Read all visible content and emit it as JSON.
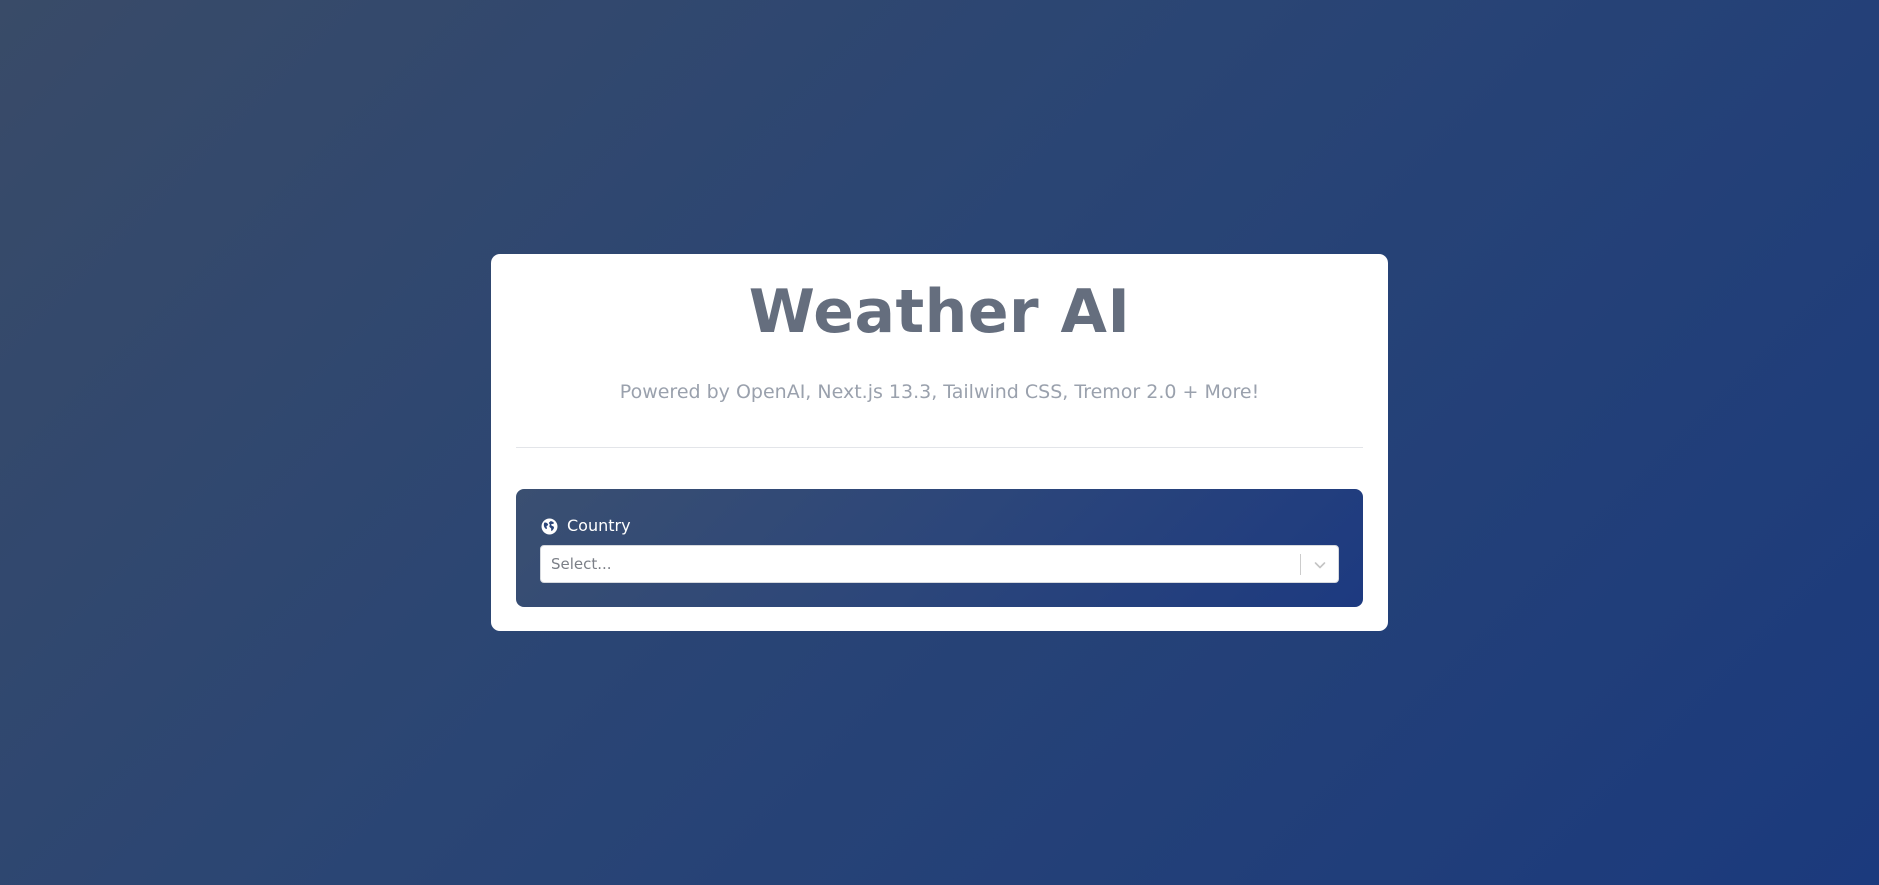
{
  "app": {
    "title": "Weather AI",
    "subtitle": "Powered by OpenAI, Next.js 13.3, Tailwind CSS, Tremor 2.0 + More!"
  },
  "country_field": {
    "label": "Country",
    "icon": "globe-icon",
    "selected_value": "Select...",
    "dropdown_icon": "chevron-down-icon"
  },
  "colors": {
    "background_start": "#394b68",
    "background_end": "#1b3a7d",
    "card": "#ffffff",
    "title": "#656e7e",
    "subtitle": "#9aa1ad",
    "panel_start": "#3a4f71",
    "panel_end": "#1d3a80"
  }
}
